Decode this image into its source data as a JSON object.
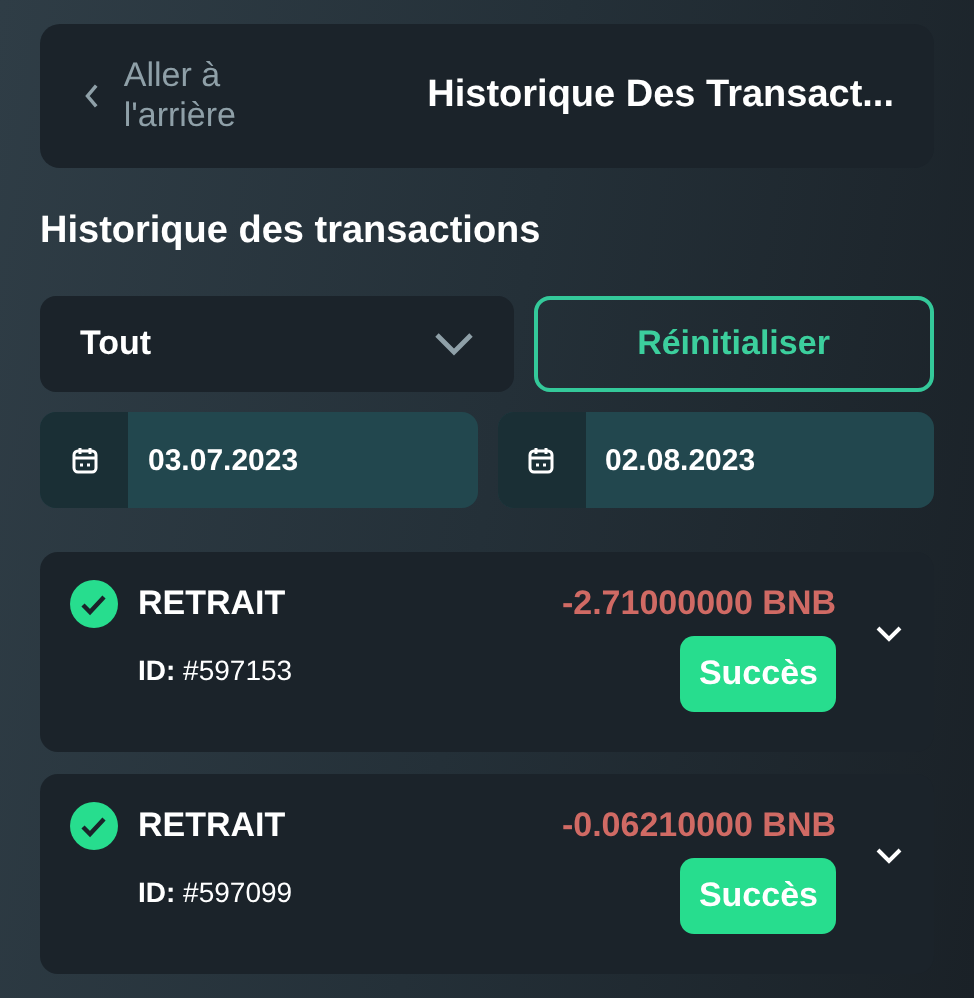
{
  "header": {
    "back_label": "Aller à l'arrière",
    "title": "Historique Des Transact..."
  },
  "section_title": "Historique des transactions",
  "filter": {
    "value": "Tout"
  },
  "reset_button": "Réinitialiser",
  "date_range": [
    {
      "value": "03.07.2023"
    },
    {
      "value": "02.08.2023"
    }
  ],
  "transactions": [
    {
      "type": "RETRAIT",
      "amount": "-2.71000000 BNB",
      "id": "**ID:** #597153",
      "status": "Succès"
    },
    {
      "type": "RETRAIT",
      "amount": "-0.06210000 BNB",
      "id": "**ID:** #597099",
      "status": "Succès"
    }
  ]
}
